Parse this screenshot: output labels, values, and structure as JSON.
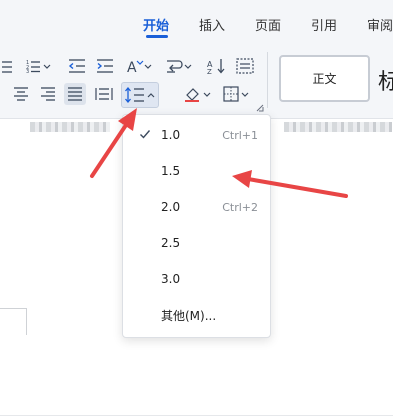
{
  "tabs": [
    {
      "label": "开始",
      "active": true
    },
    {
      "label": "插入"
    },
    {
      "label": "页面"
    },
    {
      "label": "引用"
    },
    {
      "label": "审阅"
    }
  ],
  "styles": {
    "current": "正文",
    "next_partial": "标"
  },
  "line_spacing_menu": {
    "items": [
      {
        "label": "1.0",
        "shortcut": "Ctrl+1",
        "checked": true
      },
      {
        "label": "1.5",
        "shortcut": ""
      },
      {
        "label": "2.0",
        "shortcut": "Ctrl+2"
      },
      {
        "label": "2.5",
        "shortcut": ""
      },
      {
        "label": "3.0",
        "shortcut": ""
      },
      {
        "label": "其他(M)...",
        "shortcut": ""
      }
    ]
  },
  "icons": {
    "list": "unordered-list-icon",
    "numbered": "numbered-list-icon",
    "outdent": "decrease-indent-icon",
    "indent": "increase-indent-icon",
    "font_size": "text-size-icon",
    "wrap": "text-wrap-icon",
    "sort": "sort-icon",
    "borders": "borders-icon",
    "align_center": "align-center-icon",
    "align_right": "align-right-icon",
    "justify": "justify-icon",
    "distributed": "distributed-align-icon",
    "line_spacing": "line-spacing-icon",
    "shading": "shading-icon",
    "table_border": "table-borders-icon"
  },
  "colors": {
    "accent": "#1a5fd8",
    "annotation_arrow": "#e84545",
    "ribbon_bg": "#f4f6f9"
  }
}
